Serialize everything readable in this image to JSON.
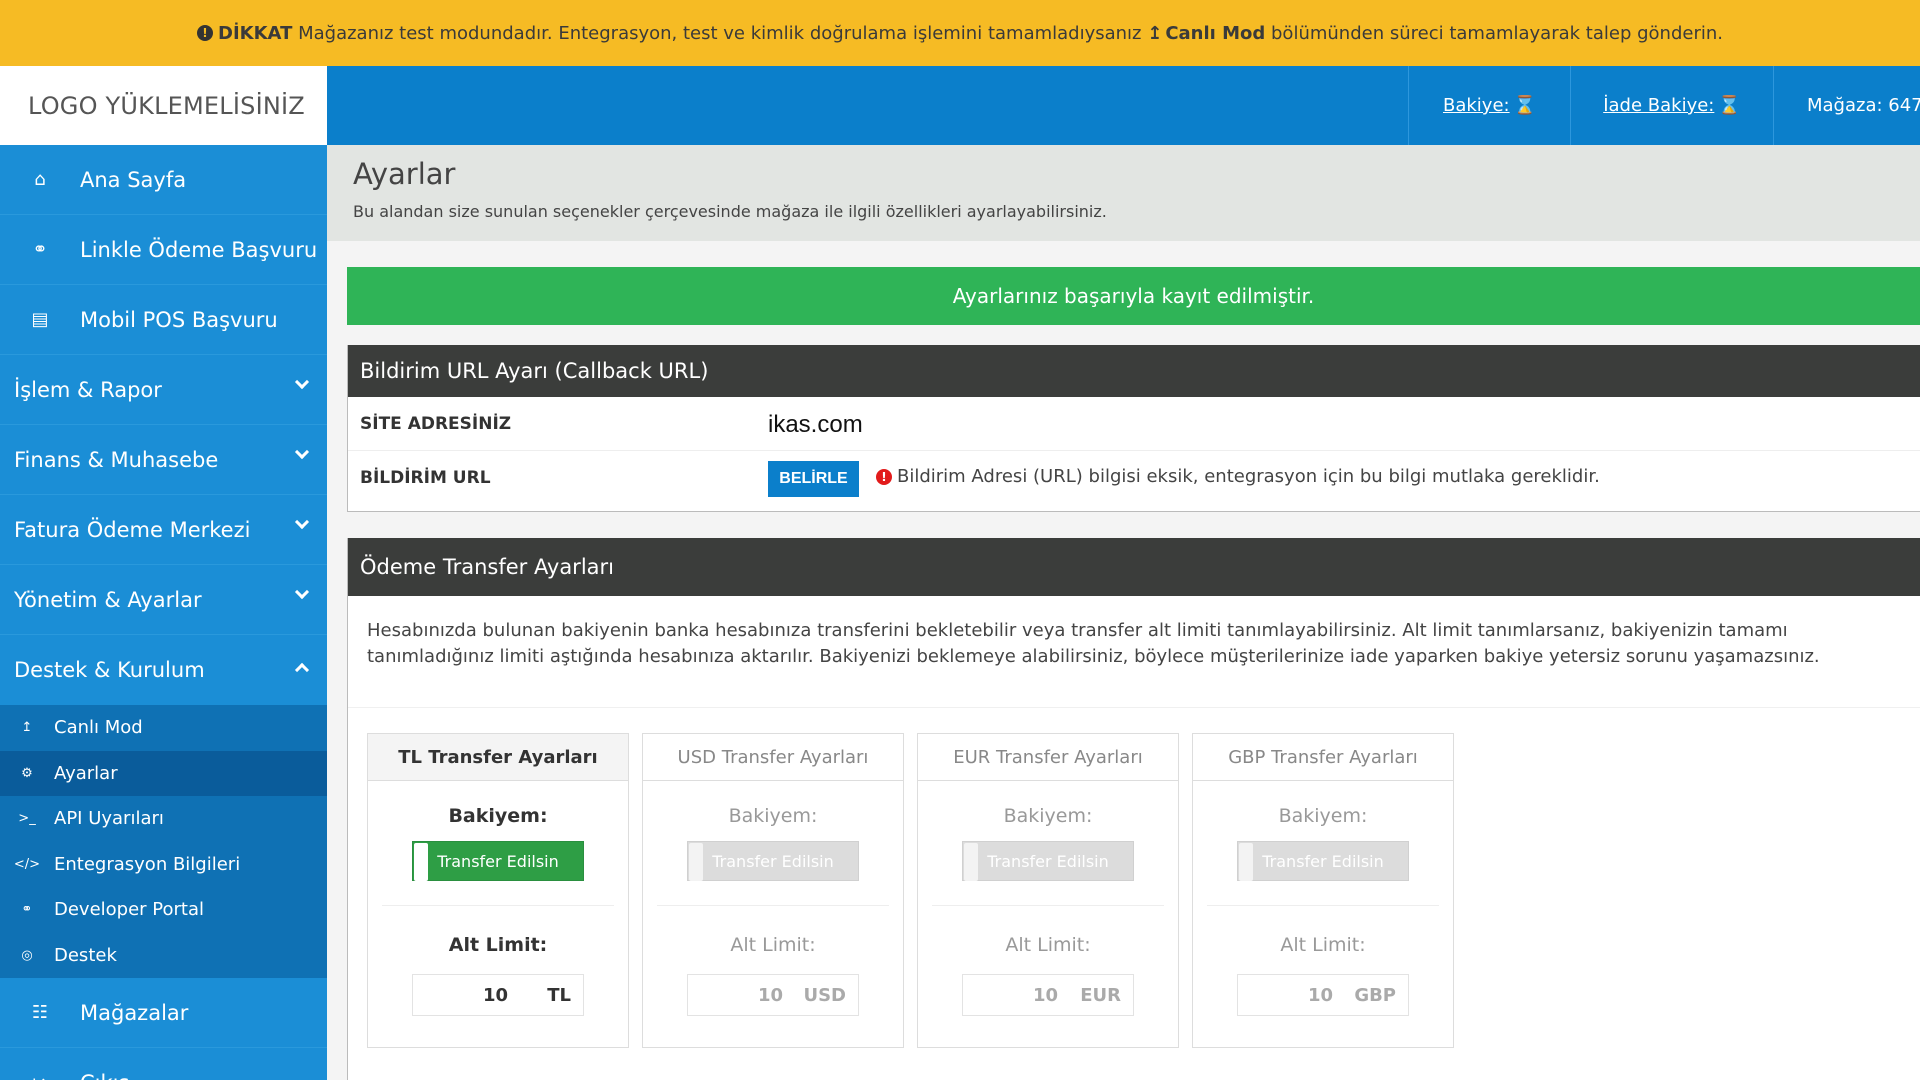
{
  "warning": {
    "strong": "DİKKAT",
    "text1": " Mağazanız test modundadır. Entegrasyon, test ve kimlik doğrulama işlemini tamamladıysanız ",
    "link_label": "Canlı Mod",
    "text2": " bölümünden süreci tamamlayarak talep gönderin."
  },
  "header": {
    "logo": "LOGO YÜKLEMELİSİNİZ",
    "balance_label": "Bakiye:",
    "refund_balance_label": "İade Bakiye:",
    "store_label": "Mağaza: 647"
  },
  "sidebar": {
    "items": [
      {
        "label": "Ana Sayfa",
        "icon": "home-icon"
      },
      {
        "label": "Linkle Ödeme Başvuru",
        "icon": "link-icon"
      },
      {
        "label": "Mobil POS Başvuru",
        "icon": "credit-card-icon"
      }
    ],
    "groups": [
      {
        "label": "İşlem & Rapor"
      },
      {
        "label": "Finans & Muhasebe"
      },
      {
        "label": "Fatura Ödeme Merkezi"
      },
      {
        "label": "Yönetim & Ayarlar"
      },
      {
        "label": "Destek & Kurulum"
      }
    ],
    "subitems": [
      {
        "label": "Canlı Mod",
        "icon": "upload-icon"
      },
      {
        "label": "Ayarlar",
        "icon": "gears-icon"
      },
      {
        "label": "API Uyarıları",
        "icon": "terminal-icon"
      },
      {
        "label": "Entegrasyon Bilgileri",
        "icon": "code-icon"
      },
      {
        "label": "Developer Portal",
        "icon": "link-icon"
      },
      {
        "label": "Destek",
        "icon": "lifebuoy-icon"
      }
    ],
    "bottom": [
      {
        "label": "Mağazalar",
        "icon": "sitemap-icon"
      },
      {
        "label": "Çıkış",
        "icon": "logout-icon"
      }
    ]
  },
  "page": {
    "title": "Ayarlar",
    "description": "Bu alandan size sunulan seçenekler çerçevesinde mağaza ile ilgili özellikleri ayarlayabilirsiniz."
  },
  "success_message": "Ayarlarınız başarıyla kayıt edilmiştir.",
  "callback": {
    "title": "Bildirim URL Ayarı (Callback URL)",
    "site_label": "SİTE ADRESİNİZ",
    "site_value": "ikas.com",
    "notify_label": "BİLDİRİM URL",
    "set_button": "BELİRLE",
    "warning": "Bildirim Adresi (URL) bilgisi eksik, entegrasyon için bu bilgi mutlaka gereklidir."
  },
  "transfer": {
    "title": "Ödeme Transfer Ayarları",
    "description": "Hesabınızda bulunan bakiyenin banka hesabınıza transferini bekletebilir veya transfer alt limiti tanımlayabilirsiniz. Alt limit tanımlarsanız, bakiyenizin tamamı tanımladığınız limiti aştığında hesabınıza aktarılır. Bakiyenizi beklemeye alabilirsiniz, böylece müşterilerinize iade yaparken bakiye yetersiz sorunu yaşamazsınız.",
    "cards": [
      {
        "title": "TL Transfer Ayarları",
        "balance_label": "Bakiyem:",
        "toggle": "Transfer Edilsin",
        "limit_label": "Alt Limit:",
        "limit_value": "10",
        "currency": "TL",
        "active": true
      },
      {
        "title": "USD Transfer Ayarları",
        "balance_label": "Bakiyem:",
        "toggle": "Transfer Edilsin",
        "limit_label": "Alt Limit:",
        "limit_value": "10",
        "currency": "USD",
        "active": false
      },
      {
        "title": "EUR Transfer Ayarları",
        "balance_label": "Bakiyem:",
        "toggle": "Transfer Edilsin",
        "limit_label": "Alt Limit:",
        "limit_value": "10",
        "currency": "EUR",
        "active": false
      },
      {
        "title": "GBP Transfer Ayarları",
        "balance_label": "Bakiyem:",
        "toggle": "Transfer Edilsin",
        "limit_label": "Alt Limit:",
        "limit_value": "10",
        "currency": "GBP",
        "active": false
      }
    ]
  },
  "colors": {
    "warning_bar": "#f6bb24",
    "header_blue": "#0b7fcb",
    "sidebar_blue": "#1b8ed6",
    "success_green": "#2fb457",
    "panel_dark": "#3b3d3b"
  }
}
